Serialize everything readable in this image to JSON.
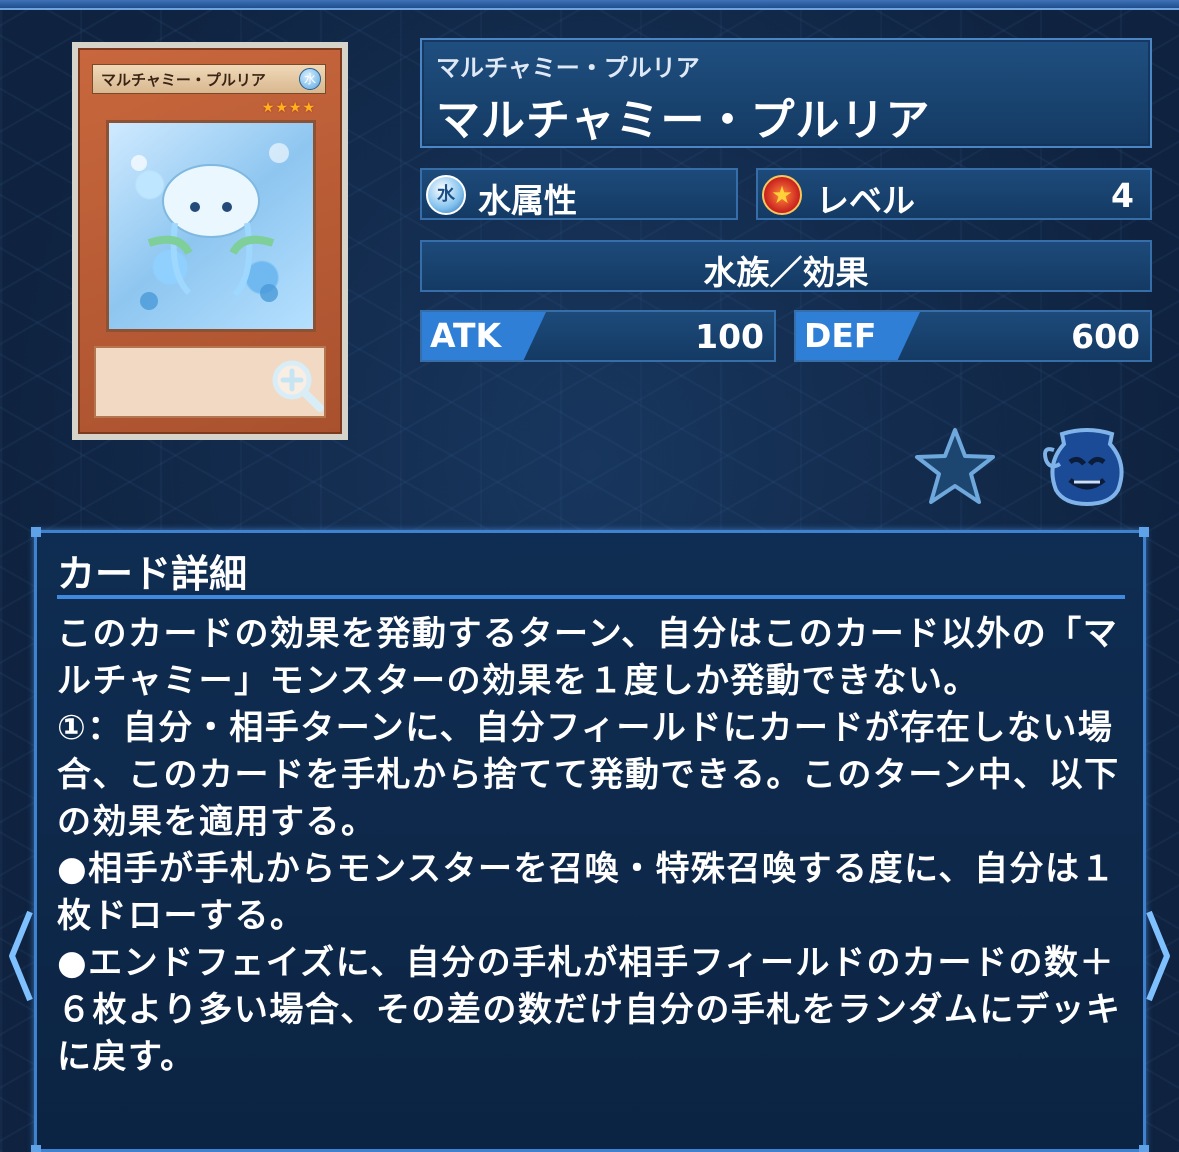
{
  "card": {
    "image_name": "マルチャミー・プルリア",
    "image_attr": "水",
    "image_stars": "★★★★"
  },
  "header": {
    "ruby": "マルチャミー・プルリア",
    "name": "マルチャミー・プルリア"
  },
  "stats": {
    "attribute_icon": "水",
    "attribute": "水属性",
    "level_label": "レベル",
    "level_value": "4",
    "type": "水族／効果",
    "atk_label": "ATK",
    "atk_value": "100",
    "def_label": "DEF",
    "def_value": "600"
  },
  "icons": {
    "favorite": "star-icon",
    "deck": "pot-icon",
    "zoom": "zoom-in-icon",
    "prev": "chevron-left-icon",
    "next": "chevron-right-icon"
  },
  "details": {
    "title": "カード詳細",
    "text": "このカードの効果を発動するターン、自分はこのカード以外の「マルチャミー」モンスターの効果を１度しか発動できない。\n①：自分・相手ターンに、自分フィールドにカードが存在しない場合、このカードを手札から捨てて発動できる。このターン中、以下の効果を適用する。\n●相手が手札からモンスターを召喚・特殊召喚する度に、自分は１枚ドローする。\n●エンドフェイズに、自分の手札が相手フィールドのカードの数＋６枚より多い場合、その差の数だけ自分の手札をランダムにデッキに戻す。"
  },
  "colors": {
    "accent": "#3f82d0",
    "tag": "#2f7fd6",
    "background": "#0f2340"
  }
}
